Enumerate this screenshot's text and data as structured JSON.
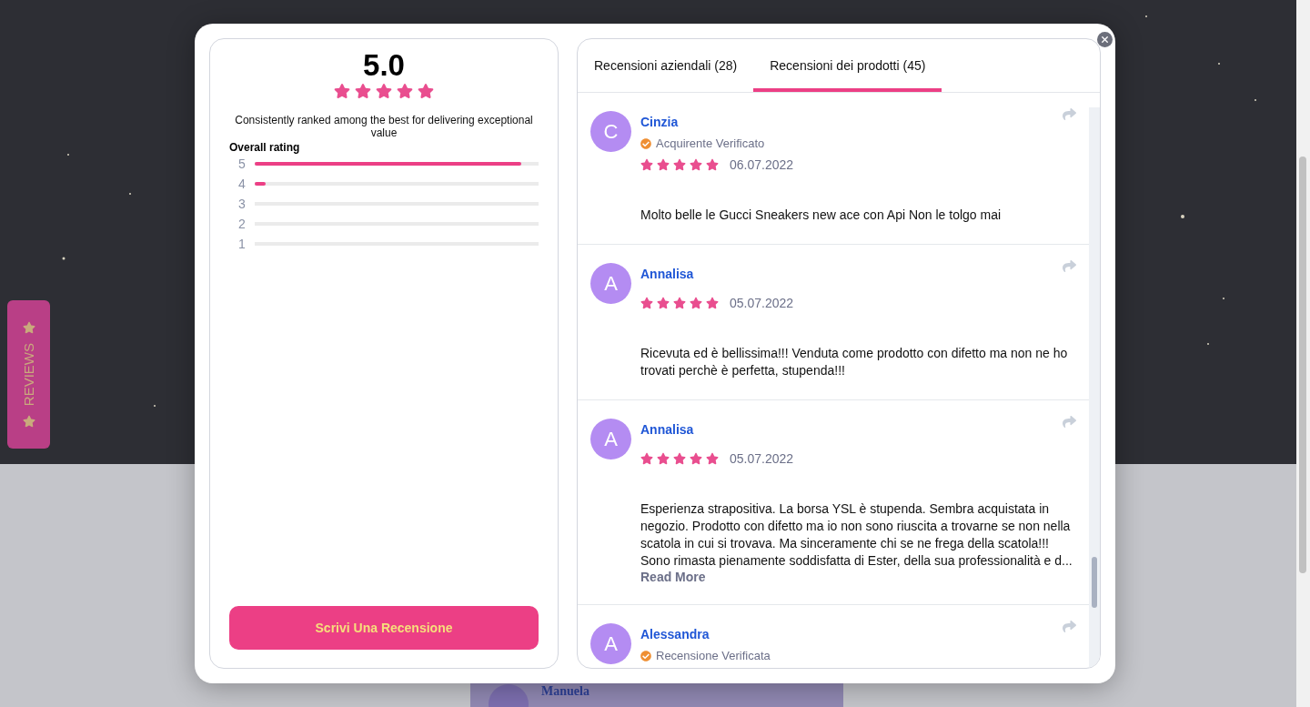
{
  "side_tab": {
    "label": "REVIEWS"
  },
  "background_review": {
    "name": "Manuela"
  },
  "summary": {
    "score": "5.0",
    "stars": 5,
    "tagline": "Consistently ranked among the best for delivering exceptional value",
    "breakdown_title": "Overall rating",
    "breakdown": [
      {
        "label": "5",
        "level": 0.94
      },
      {
        "label": "4",
        "level": 0.04
      },
      {
        "label": "3"
      },
      {
        "label": "2"
      },
      {
        "label": "1"
      }
    ],
    "write_button": "Scrivi Una Recensione"
  },
  "tabs": [
    {
      "label": "Recensioni aziendali (28)",
      "selected": false
    },
    {
      "label": "Recensioni dei prodotti (45)",
      "selected": true
    }
  ],
  "reviews": [
    {
      "initial": "C",
      "name": "Cinzia",
      "badge": "Acquirente Verificato",
      "stars": 5,
      "date": "06.07.2022",
      "text": "Molto belle le Gucci Sneakers new ace con Api Non le tolgo mai"
    },
    {
      "initial": "A",
      "name": "Annalisa",
      "stars": 5,
      "date": "05.07.2022",
      "text": "Ricevuta ed è bellissima!!! Venduta come prodotto con difetto ma non ne ho trovati perchè è perfetta, stupenda!!!"
    },
    {
      "initial": "A",
      "name": "Annalisa",
      "stars": 5,
      "date": "05.07.2022",
      "text": "Esperienza strapositiva. La borsa YSL è stupenda. Sembra acquistata in negozio. Prodotto con difetto ma io non sono riuscita a trovarne se non nella scatola in cui si trovava. Ma sinceramente chi se ne frega della scatola!!! Sono rimasta pienamente soddisfatta di Ester, della sua professionalità e d...",
      "read_more": "Read More"
    },
    {
      "initial": "A",
      "name": "Alessandra",
      "badge": "Recensione Verificata"
    }
  ]
}
